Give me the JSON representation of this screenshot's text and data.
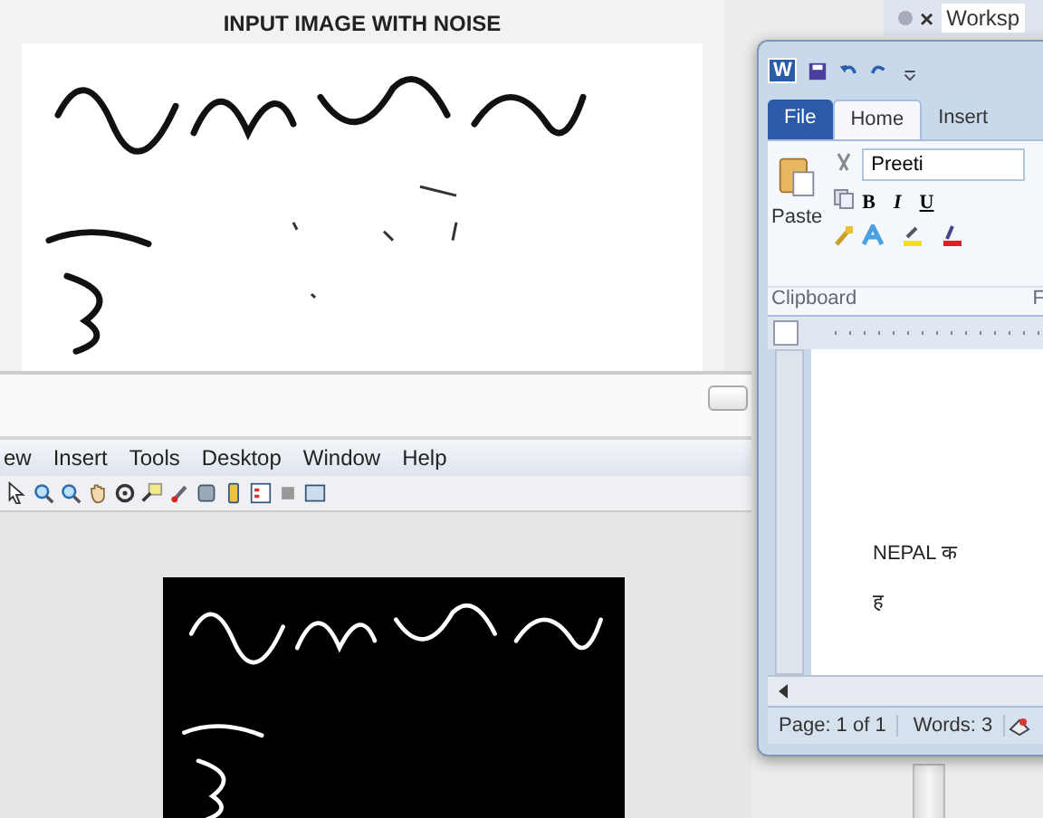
{
  "figure": {
    "title": "INPUT IMAGE WITH NOISE"
  },
  "figure_window": {
    "menu": [
      "ew",
      "Insert",
      "Tools",
      "Desktop",
      "Window",
      "Help"
    ]
  },
  "workspace": {
    "close_label": "×",
    "title": "Worksp"
  },
  "word": {
    "app_letter": "W",
    "tabs": [
      {
        "label": "File",
        "selected": false
      },
      {
        "label": "Home",
        "selected": true
      },
      {
        "label": "Insert",
        "selected": false
      }
    ],
    "paste_label": "Paste",
    "font_name": "Preeti",
    "format_buttons": [
      "B",
      "I",
      "U"
    ],
    "group_labels": [
      "Clipboard",
      "F"
    ],
    "document_lines": [
      "NEPAL क",
      "ह"
    ],
    "status": [
      "Page: 1 of 1",
      "Words: 3"
    ]
  }
}
